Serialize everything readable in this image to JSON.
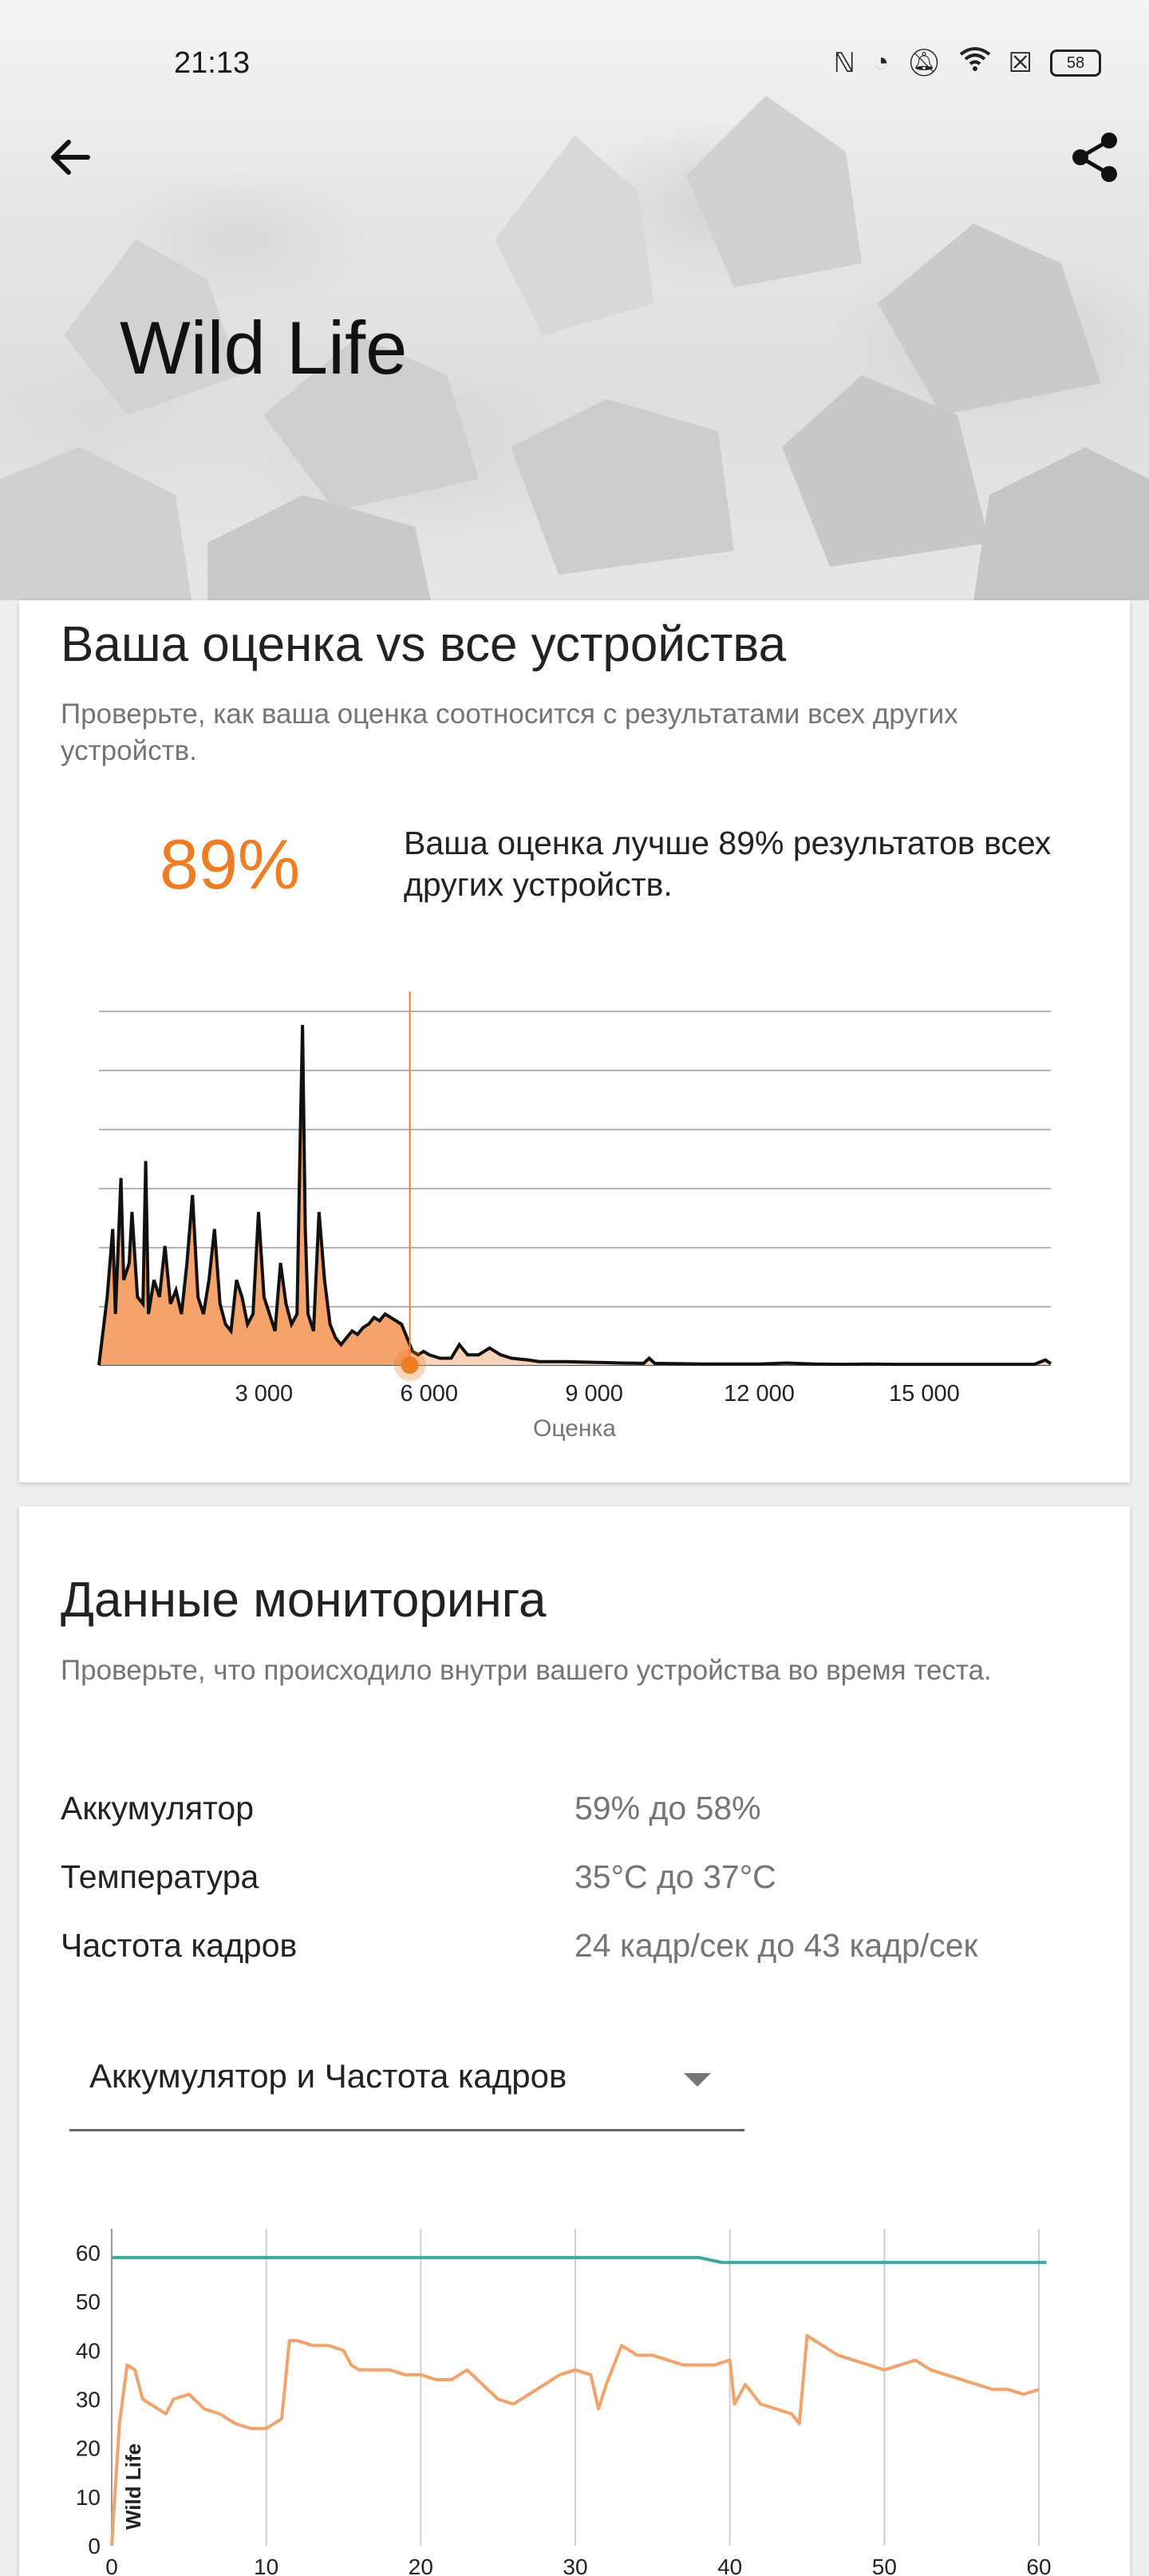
{
  "status_bar": {
    "time": "21:13",
    "icons": [
      "nfc-icon",
      "speedometer-icon",
      "mute-icon",
      "wifi-icon",
      "sim-blocked-icon"
    ],
    "battery": "58"
  },
  "header": {
    "title": "Wild Life",
    "back_icon": "arrow-back-icon",
    "share_icon": "share-icon"
  },
  "comparison": {
    "title": "Ваша оценка vs все устройства",
    "description": "Проверьте, как ваша оценка соотносится с результатами всех других устройств.",
    "percent": "89%",
    "percent_text": "Ваша оценка лучше 89% результатов всех других устройств.",
    "accent_color": "#f07c24"
  },
  "chart_data": [
    {
      "type": "area",
      "xlabel": "Оценка",
      "x_ticks": [
        "3 000",
        "6 000",
        "9 000",
        "12 000",
        "15 000"
      ],
      "xlim": [
        0,
        17300
      ],
      "user_score": 5650,
      "grid": true,
      "x": [
        0,
        150,
        250,
        300,
        400,
        450,
        550,
        600,
        700,
        800,
        850,
        900,
        1000,
        1100,
        1200,
        1300,
        1400,
        1500,
        1600,
        1700,
        1800,
        1900,
        2000,
        2100,
        2200,
        2300,
        2400,
        2500,
        2600,
        2700,
        2800,
        2900,
        3000,
        3100,
        3200,
        3300,
        3400,
        3500,
        3600,
        3650,
        3700,
        3750,
        3800,
        3900,
        4000,
        4100,
        4200,
        4300,
        4400,
        4500,
        4600,
        4700,
        4800,
        4900,
        5000,
        5100,
        5200,
        5300,
        5400,
        5500,
        5600,
        5650,
        5700,
        5800,
        5900,
        6000,
        6200,
        6400,
        6550,
        6700,
        6900,
        7100,
        7300,
        7500,
        7800,
        8000,
        8500,
        9000,
        9500,
        9900,
        10000,
        10100,
        10500,
        11000,
        11500,
        12000,
        12500,
        13000,
        13500,
        14000,
        14500,
        15000,
        15500,
        16000,
        16500,
        17000,
        17200,
        17300
      ],
      "y": [
        0,
        20,
        40,
        15,
        55,
        25,
        30,
        45,
        20,
        18,
        60,
        15,
        25,
        20,
        35,
        18,
        22,
        15,
        30,
        50,
        20,
        15,
        25,
        40,
        18,
        12,
        10,
        25,
        20,
        12,
        15,
        45,
        20,
        15,
        10,
        30,
        18,
        12,
        15,
        60,
        100,
        40,
        15,
        10,
        45,
        25,
        12,
        8,
        6,
        8,
        10,
        9,
        11,
        12,
        14,
        13,
        15,
        14,
        13,
        12,
        8,
        6,
        4,
        3,
        4,
        3,
        2,
        2,
        6,
        3,
        3,
        5,
        3,
        2,
        1.5,
        1,
        1,
        0.8,
        0.6,
        0.5,
        2,
        0.5,
        0.4,
        0.3,
        0.3,
        0.3,
        0.6,
        0.3,
        0.2,
        0.3,
        0.2,
        0.2,
        0.2,
        0.2,
        0.2,
        0.2,
        1.5,
        0.4
      ],
      "fill_color": "#f5a36a",
      "fill_after_color": "#f8d2b9"
    },
    {
      "type": "line",
      "y_ticks": [
        "0",
        "10",
        "20",
        "30",
        "40",
        "50",
        "60"
      ],
      "x_ticks": [
        "0",
        "10",
        "20",
        "30",
        "40",
        "50",
        "60"
      ],
      "ylim": [
        0,
        60
      ],
      "xlim": [
        0,
        60
      ],
      "inner_label": "Wild Life",
      "grid": true,
      "series": [
        {
          "color": "#3aa99f",
          "x": [
            0,
            38,
            39.5,
            60.5
          ],
          "y": [
            59,
            59,
            58,
            58
          ]
        },
        {
          "color": "#f2a36a",
          "x": [
            0,
            0.5,
            1,
            1.5,
            2,
            3,
            3.5,
            4,
            5,
            6,
            7,
            8,
            9,
            10,
            11,
            11.5,
            12,
            13,
            14,
            15,
            15.5,
            16,
            17,
            18,
            19,
            20,
            21,
            22,
            23,
            24,
            25,
            26,
            27,
            28,
            29,
            30,
            31,
            31.5,
            32,
            33,
            34,
            35,
            36,
            37,
            38,
            39,
            40,
            40.3,
            41,
            42,
            43,
            44,
            44.5,
            45,
            46,
            47,
            48,
            49,
            50,
            51,
            52,
            53,
            54,
            55,
            56,
            57,
            58,
            59,
            60
          ],
          "y": [
            0,
            25,
            37,
            36,
            30,
            28,
            27,
            30,
            31,
            28,
            27,
            25,
            24,
            24,
            26,
            42,
            42,
            41,
            41,
            40,
            37,
            36,
            36,
            36,
            35,
            35,
            34,
            34,
            36,
            33,
            30,
            29,
            31,
            33,
            35,
            36,
            35,
            28,
            33,
            41,
            39,
            39,
            38,
            37,
            37,
            37,
            38,
            29,
            33,
            29,
            28,
            27,
            25,
            43,
            41,
            39,
            38,
            37,
            36,
            37,
            38,
            36,
            35,
            34,
            33,
            32,
            32,
            31,
            32
          ]
        }
      ]
    }
  ],
  "monitoring": {
    "title": "Данные мониторинга",
    "description": "Проверьте, что происходило внутри вашего устройства во время теста.",
    "rows": [
      {
        "label": "Аккумулятор",
        "value": "59% до 58%"
      },
      {
        "label": "Температура",
        "value": "35°C до 37°C"
      },
      {
        "label": "Частота кадров",
        "value": "24 кадр/сек до 43 кадр/сек"
      }
    ],
    "dropdown_selected": "Аккумулятор и Частота кадров"
  }
}
